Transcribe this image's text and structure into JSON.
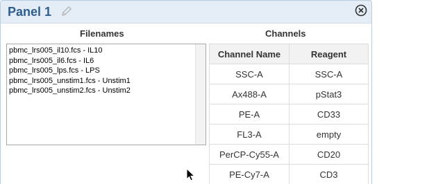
{
  "panel": {
    "title": "Panel 1",
    "edit_icon": "pencil-icon",
    "close_icon": "close-circle-icon"
  },
  "filenames": {
    "heading": "Filenames",
    "items": [
      "pbmc_lrs005_il10.fcs - IL10",
      "pbmc_lrs005_il6.fcs - IL6",
      "pbmc_lrs005_lps.fcs - LPS",
      "pbmc_lrs005_unstim1.fcs - Unstim1",
      "pbmc_lrs005_unstim2.fcs - Unstim2"
    ]
  },
  "channels": {
    "heading": "Channels",
    "columns": [
      "Channel Name",
      "Reagent"
    ],
    "rows": [
      [
        "SSC-A",
        "SSC-A"
      ],
      [
        "Ax488-A",
        "pStat3"
      ],
      [
        "PE-A",
        "CD33"
      ],
      [
        "FL3-A",
        "empty"
      ],
      [
        "PerCP-Cy55-A",
        "CD20"
      ],
      [
        "PE-Cy7-A",
        "CD3"
      ]
    ]
  },
  "colors": {
    "title": "#2e5d8f",
    "header_bg": "#e4edf6",
    "border": "#b9cde0"
  }
}
